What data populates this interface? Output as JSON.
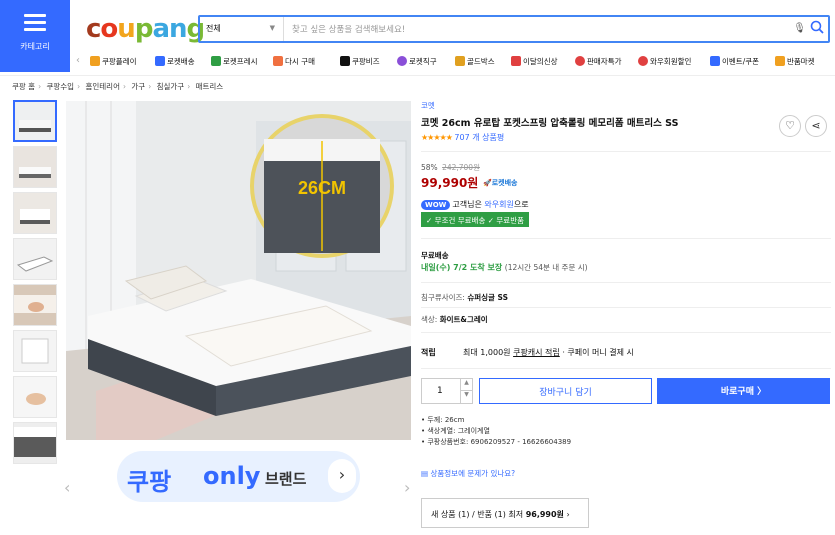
{
  "header": {
    "menu_label": "카테고리",
    "logo": [
      "c",
      "o",
      "u",
      "p",
      "a",
      "n",
      "g"
    ],
    "search": {
      "category": "전체",
      "placeholder": "찾고 싶은 상품을 검색해보세요!"
    }
  },
  "shortcuts": [
    {
      "label": "쿠팡플레이",
      "icon_color": "#f0a020"
    },
    {
      "label": "로켓배송",
      "icon_color": "#346aff"
    },
    {
      "label": "로켓프레시",
      "icon_color": "#2f9e44"
    },
    {
      "label": "다시 구매",
      "icon_color": "#f07040"
    },
    {
      "label": "쿠팡비즈",
      "icon_color": "#111111"
    },
    {
      "label": "로켓직구",
      "icon_color": "#8a4fd8"
    },
    {
      "label": "골드박스",
      "icon_color": "#e0a020"
    },
    {
      "label": "이달의신상",
      "icon_color": "#e04040"
    },
    {
      "label": "판매자특가",
      "icon_color": "#e04040"
    },
    {
      "label": "와우회원할인",
      "icon_color": "#e04040"
    },
    {
      "label": "이벤트/쿠폰",
      "icon_color": "#346aff"
    },
    {
      "label": "반품마켓",
      "icon_color": "#f0a020"
    }
  ],
  "breadcrumb": [
    "쿠팡 홈",
    "쿠팡수입",
    "홈인테리어",
    "가구",
    "침실가구",
    "매트리스"
  ],
  "image": {
    "badge": "26CM"
  },
  "banner": {
    "part1": "쿠팡",
    "part2": "only",
    "part3": "브랜드"
  },
  "product": {
    "brand": "코멧",
    "title": "코멧 26cm 유로탑 포켓스프링 압축롤링 메모리폼 매트리스 SS",
    "stars": "★★★★★",
    "reviews": "707 개 상품평",
    "discount_rate": "58%",
    "original_price": "242,700원",
    "price": "99,990원",
    "rocket": "로켓배송",
    "wow_badge": "WOW",
    "wow_text_pre": "고객님은 ",
    "wow_link": "와우회원",
    "wow_text_post": "으로",
    "free_tags": "✓ 무조건 무료배송 ✓ 무료반품",
    "shipping_title": "무료배송",
    "shipping_date": "내일(수) 7/2 도착 보장",
    "shipping_sub": "(12시간 54분 내 주문 시)",
    "size_label": "침구류사이즈: ",
    "size_value": "슈퍼싱글 SS",
    "color_label": "색상: ",
    "color_value": "화이트&그레이",
    "points_key": "적립",
    "points_pre": "최대 1,000원 ",
    "points_link": "쿠팡캐시 적립",
    "points_post": " · 쿠페이 머니 결제 시",
    "quantity": "1",
    "cart_button": "장바구니 담기",
    "buy_button": "바로구매 〉",
    "specs": [
      "• 두께: 26cm",
      "• 색상계열: 그레이계열",
      "• 쿠팡상품번호: 6906209527 - 16626604389"
    ],
    "report": "상품정보에 문제가 있나요?",
    "other_sellers": "새 상품 (1) / 반품 (1) 최저 ",
    "other_price": "96,990원",
    "other_arrow": " ›"
  },
  "colors": {
    "accent": "#346aff",
    "price": "#ae0000",
    "green": "#2f9e44"
  }
}
